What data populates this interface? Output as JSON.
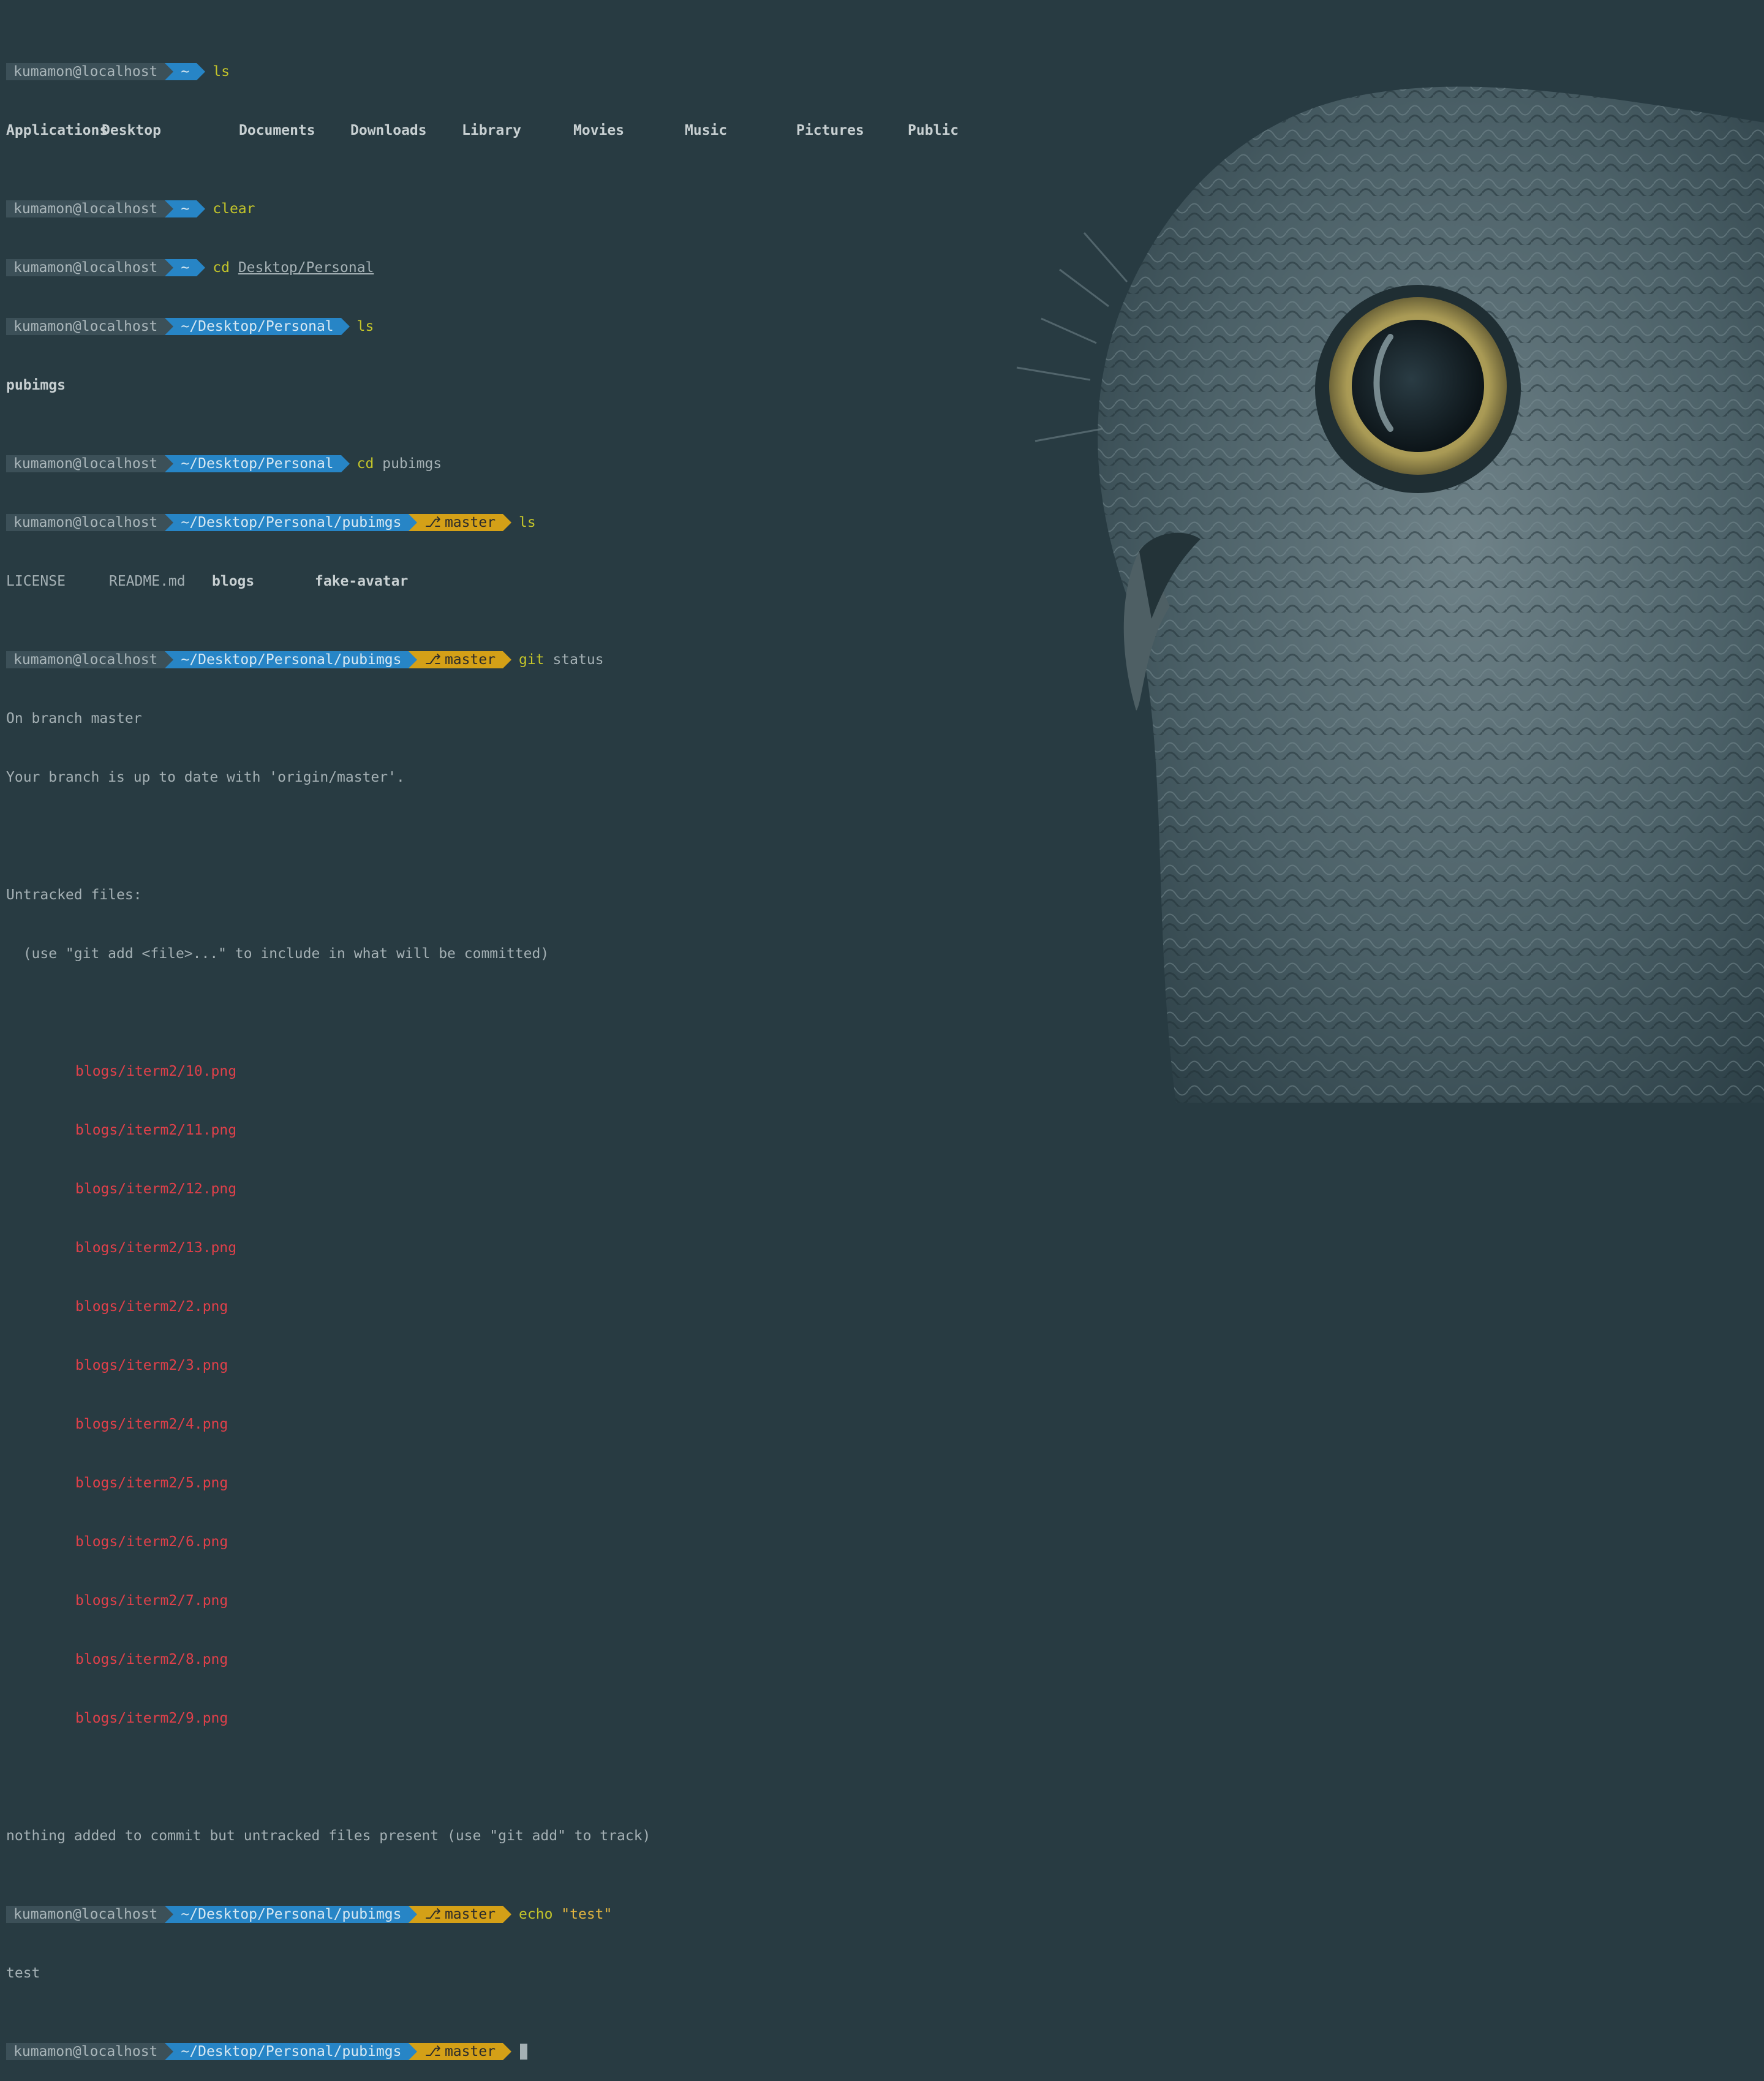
{
  "prompt": {
    "context": "kumamon@localhost",
    "branch_icon": "⎇"
  },
  "dirs": {
    "home": "~",
    "personal": "~/Desktop/Personal",
    "pubimgs": "~/Desktop/Personal/pubimgs"
  },
  "git_branch": "master",
  "cmds": {
    "ls": "ls",
    "clear": "clear",
    "cd1": "cd",
    "cd1_arg": "Desktop/Personal",
    "cd2": "cd",
    "cd2_arg": "pubimgs",
    "git": "git",
    "git_arg": "status",
    "echo": "echo",
    "echo_arg": "\"test\""
  },
  "ls_home": [
    "Applications",
    "Desktop",
    "Documents",
    "Downloads",
    "Library",
    "Movies",
    "Music",
    "Pictures",
    "Public"
  ],
  "ls_personal": [
    "pubimgs"
  ],
  "ls_pubimgs": [
    "LICENSE",
    "README.md",
    "blogs",
    "fake-avatar"
  ],
  "git_status": {
    "branch_line": "On branch master",
    "uptodate_line": "Your branch is up to date with 'origin/master'.",
    "untracked_header": "Untracked files:",
    "untracked_hint": "  (use \"git add <file>...\" to include in what will be committed)",
    "files": [
      "blogs/iterm2/10.png",
      "blogs/iterm2/11.png",
      "blogs/iterm2/12.png",
      "blogs/iterm2/13.png",
      "blogs/iterm2/2.png",
      "blogs/iterm2/3.png",
      "blogs/iterm2/4.png",
      "blogs/iterm2/5.png",
      "blogs/iterm2/6.png",
      "blogs/iterm2/7.png",
      "blogs/iterm2/8.png",
      "blogs/iterm2/9.png"
    ],
    "summary": "nothing added to commit but untracked files present (use \"git add\" to track)"
  },
  "echo_output": "test",
  "colors": {
    "background": "#283b42",
    "dir_segment": "#2785c6",
    "git_segment": "#d4a017",
    "untracked": "#e0404a",
    "command": "#c4c52a"
  }
}
